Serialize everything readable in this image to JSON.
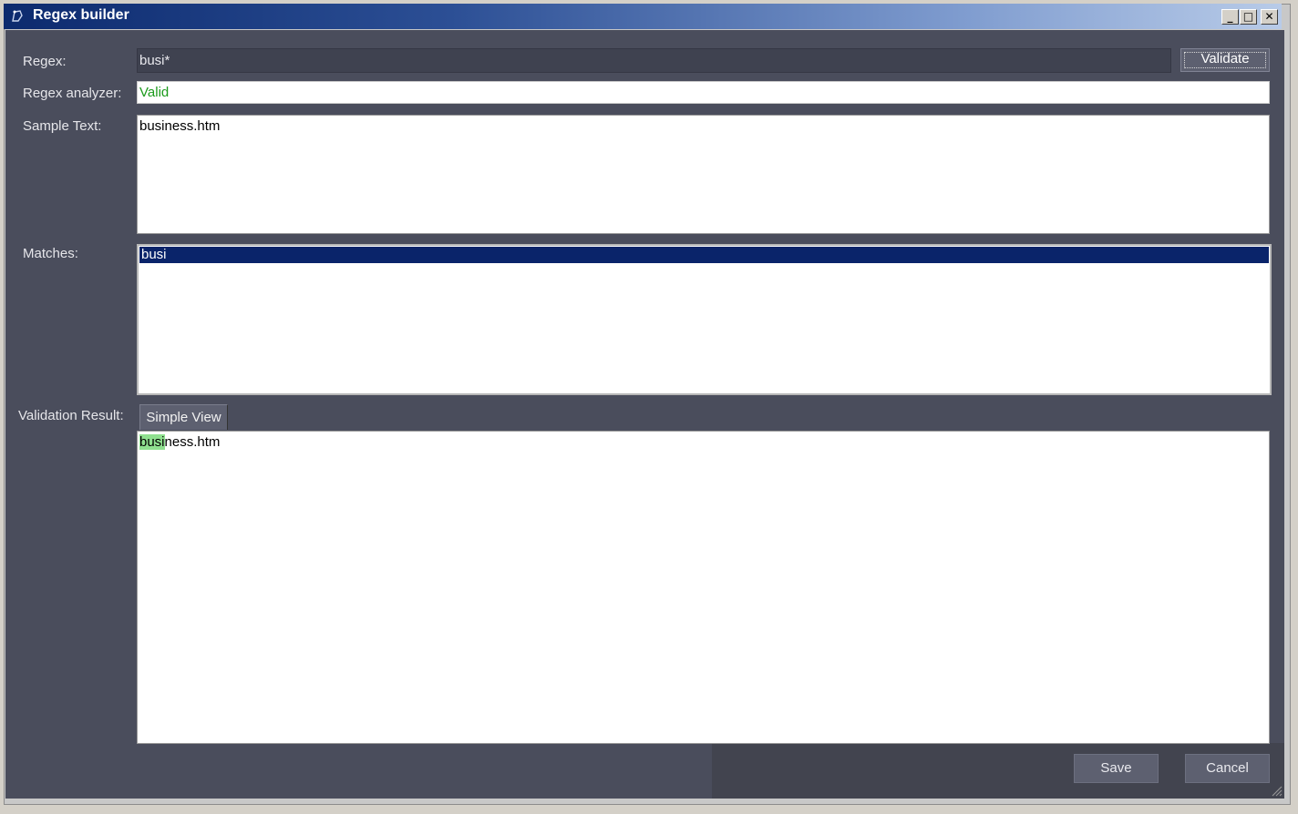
{
  "window": {
    "title": "Regex builder",
    "minimize": "_",
    "maximize": "□",
    "close": "✕",
    "icon": "regex-app-icon"
  },
  "form": {
    "regex_label": "Regex:",
    "regex_value": "busi*",
    "validate_label": "Validate",
    "analyzer_label": "Regex analyzer:",
    "analyzer_value": "Valid",
    "sample_label": "Sample Text:",
    "sample_value": "business.htm",
    "matches_label": "Matches:",
    "matches": [
      "busi"
    ],
    "result_label": "Validation Result:",
    "result_tab": "Simple View",
    "result_highlight": "busi",
    "result_rest": "ness.htm"
  },
  "footer": {
    "save_label": "Save",
    "cancel_label": "Cancel"
  },
  "colors": {
    "titlebar_start": "#0c2a6e",
    "panel_bg": "#4a4d5c",
    "valid_text": "#1b9a1b",
    "selection": "#0a246a",
    "highlight": "#8fe08f"
  }
}
